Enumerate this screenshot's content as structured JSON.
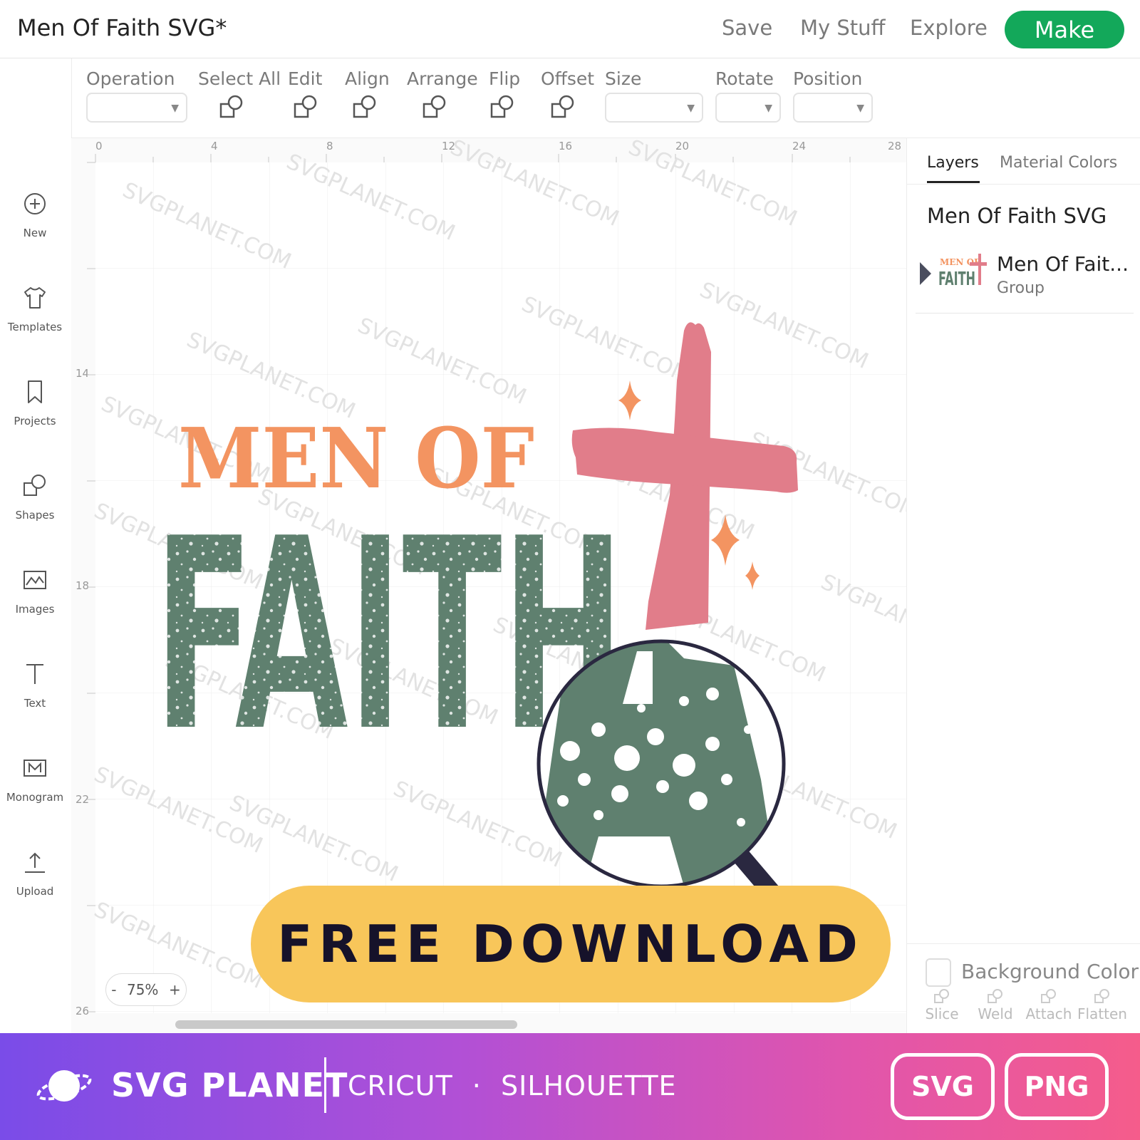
{
  "header": {
    "title": "Men Of Faith SVG*",
    "nav": [
      "Save",
      "My Stuff",
      "Explore"
    ],
    "make_label": "Make",
    "make_color": "#13a85a"
  },
  "toolbar": {
    "operation": "Operation",
    "select_all": "Select All",
    "edit": "Edit",
    "align": "Align",
    "arrange": "Arrange",
    "flip": "Flip",
    "offset": "Offset",
    "size": "Size",
    "rotate": "Rotate",
    "position": "Position"
  },
  "sidebar": {
    "items": [
      {
        "label": "New",
        "icon": "plus-circle-icon"
      },
      {
        "label": "Templates",
        "icon": "shirt-icon"
      },
      {
        "label": "Projects",
        "icon": "bookmark-icon"
      },
      {
        "label": "Shapes",
        "icon": "shapes-icon"
      },
      {
        "label": "Images",
        "icon": "image-icon"
      },
      {
        "label": "Text",
        "icon": "text-icon"
      },
      {
        "label": "Monogram",
        "icon": "monogram-icon"
      },
      {
        "label": "Upload",
        "icon": "upload-icon"
      }
    ]
  },
  "canvas": {
    "ruler_top": [
      "0",
      "4",
      "8",
      "12",
      "16",
      "20",
      "24",
      "28"
    ],
    "ruler_left": [
      "14",
      "18",
      "22",
      "26"
    ],
    "zoom_minus": "-",
    "zoom_level": "75%",
    "zoom_plus": "+",
    "watermark": "SVGPLANET.COM",
    "art_line1": "MEN OF",
    "art_line2": "FAITH",
    "download_label": "FREE DOWNLOAD",
    "colors": {
      "orange": "#f39461",
      "green": "#5f806f",
      "pink": "#e17d8a",
      "button": "#f8c65a"
    }
  },
  "right_panel": {
    "tabs": [
      "Layers",
      "Material Colors"
    ],
    "project_title": "Men Of Faith SVG",
    "layer": {
      "name": "Men Of Fait...",
      "type": "Group",
      "thumb_top": "MEN OF",
      "thumb_bottom": "FAITH"
    },
    "background_color": "Background Color",
    "tools": [
      "Slice",
      "Weld",
      "Attach",
      "Flatten"
    ]
  },
  "footer": {
    "brand": "SVG PLANET",
    "compat_1": "CRICUT",
    "compat_sep": "·",
    "compat_2": "SILHOUETTE",
    "formats": [
      "SVG",
      "PNG"
    ]
  }
}
